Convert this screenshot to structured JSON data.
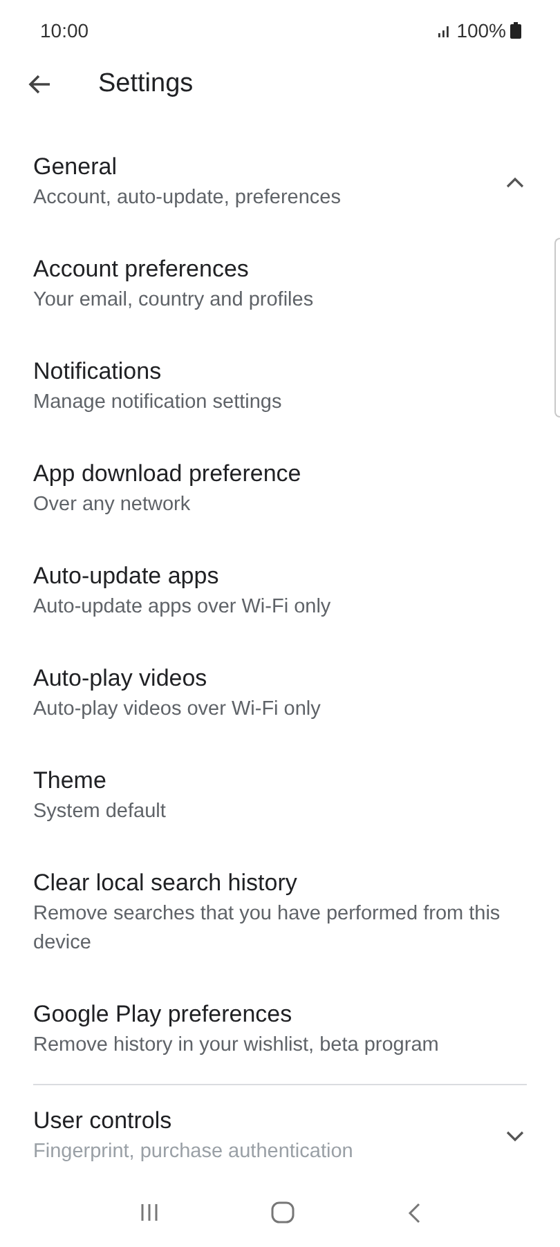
{
  "status_bar": {
    "time": "10:00",
    "battery": "100%"
  },
  "header": {
    "title": "Settings"
  },
  "sections": [
    {
      "title": "General",
      "subtitle": "Account, auto-update, preferences",
      "expanded": true,
      "items": [
        {
          "title": "Account preferences",
          "subtitle": "Your email, country and profiles"
        },
        {
          "title": "Notifications",
          "subtitle": "Manage notification settings"
        },
        {
          "title": "App download preference",
          "subtitle": "Over any network"
        },
        {
          "title": "Auto-update apps",
          "subtitle": "Auto-update apps over Wi-Fi only"
        },
        {
          "title": "Auto-play videos",
          "subtitle": "Auto-play videos over Wi-Fi only"
        },
        {
          "title": "Theme",
          "subtitle": "System default"
        },
        {
          "title": "Clear local search history",
          "subtitle": "Remove searches that you have performed from this device"
        },
        {
          "title": "Google Play preferences",
          "subtitle": "Remove history in your wishlist, beta program"
        }
      ]
    },
    {
      "title": "User controls",
      "subtitle": "Fingerprint, purchase authentication",
      "expanded": false
    }
  ]
}
